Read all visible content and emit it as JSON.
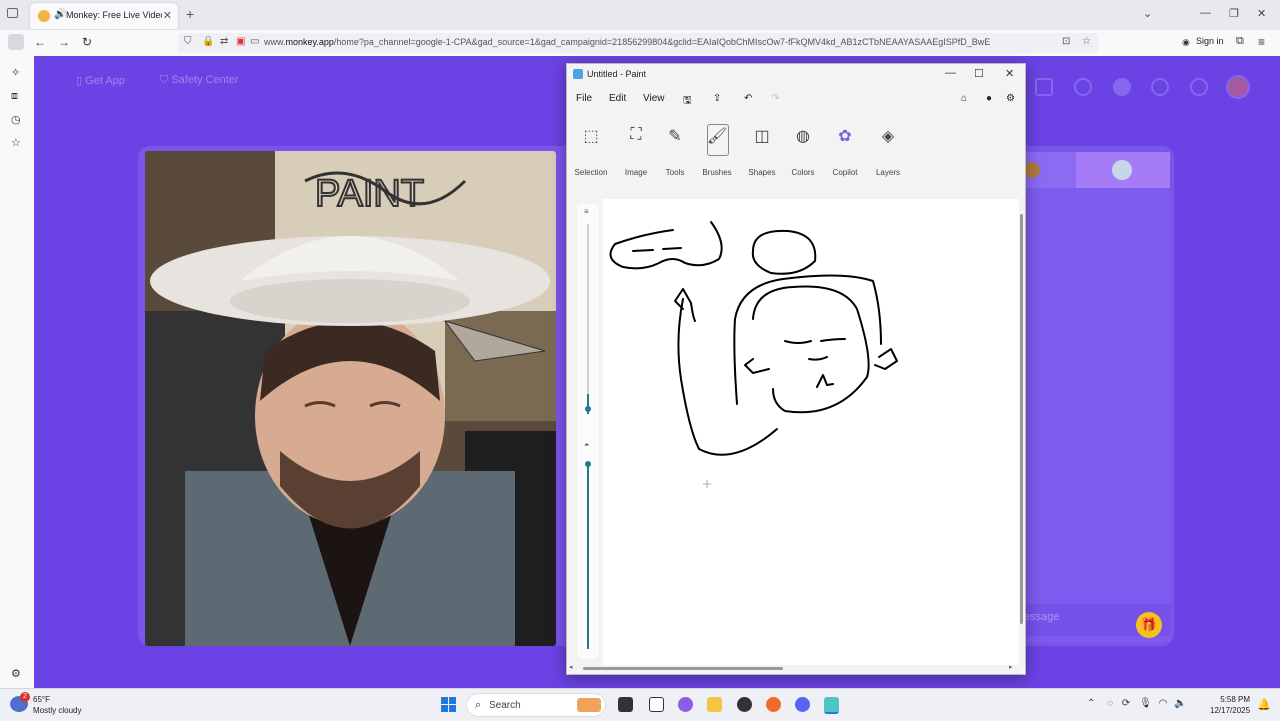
{
  "browser": {
    "tab_title": "Monkey: Free Live Video Ch",
    "url_prefix": "www.",
    "url_domain": "monkey.app",
    "url_rest": "/home?pa_channel=google-1-CPA&gad_source=1&gad_campaignid=21856299804&gclid=EAIaIQobChMIscOw7-fFkQMV4kd_AB1zCTbNEAAYASAAEgISPfD_BwE",
    "sign_in": "Sign in"
  },
  "monkey": {
    "get_app": "Get App",
    "safety_center": "Safety Center",
    "message_placeholder": "essage"
  },
  "paint": {
    "title": "Untitled - Paint",
    "menu": [
      "File",
      "Edit",
      "View"
    ],
    "tools": [
      "Selection",
      "Image",
      "Tools",
      "Brushes",
      "Shapes",
      "Colors",
      "Copilot",
      "Layers"
    ]
  },
  "taskbar": {
    "temperature": "65°F",
    "weather": "Mostly cloudy",
    "weather_badge": "2",
    "search": "Search",
    "time": "5:58 PM",
    "date": "12/17/2025"
  },
  "colors": {
    "monkey_purple": "#6b42e3",
    "paint_bg": "#f3f3f3",
    "accent_teal": "#1f7a8c"
  }
}
